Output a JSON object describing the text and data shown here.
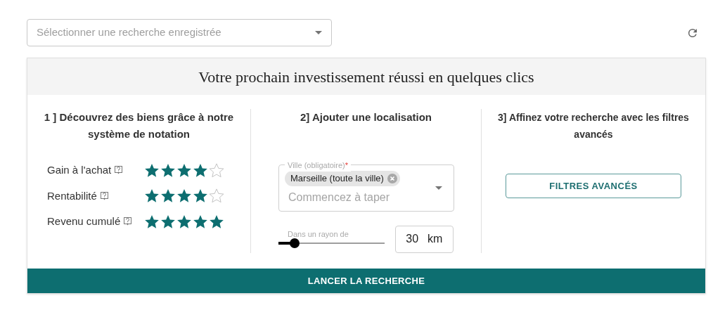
{
  "saved_search": {
    "placeholder": "Sélectionner une recherche enregistrée"
  },
  "title": "Votre prochain investissement réussi en quelques clics",
  "section_1": {
    "heading": "1 ] Découvrez des biens grâce à notre système de notation",
    "ratings": [
      {
        "label": "Gain à l'achat",
        "stars": 4
      },
      {
        "label": "Rentabilité",
        "stars": 4
      },
      {
        "label": "Revenu cumulé",
        "stars": 5
      }
    ]
  },
  "section_2": {
    "heading": "2] Ajouter une localisation",
    "city_field": {
      "label": "Ville (obligatoire)",
      "required_mark": "*",
      "chips": [
        "Marseille (toute la ville)"
      ],
      "placeholder": "Commencez à taper"
    },
    "radius": {
      "label": "Dans un rayon de",
      "level": 0.15,
      "value": "30",
      "unit": "km"
    }
  },
  "section_3": {
    "heading": "3] Affinez votre recherche avec les filtres avancés",
    "button": "FILTRES AVANCÉS"
  },
  "search_button": "LANCER LA RECHERCHE"
}
